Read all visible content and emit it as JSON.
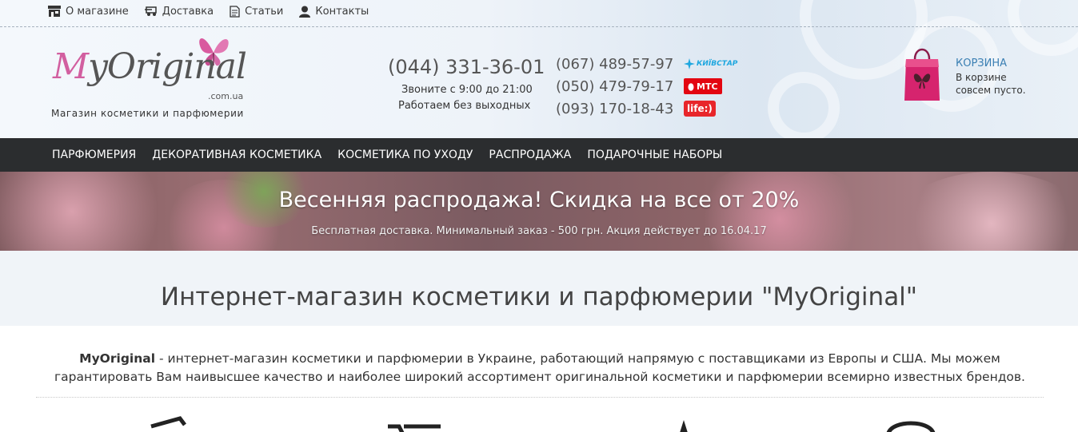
{
  "topnav": {
    "items": [
      {
        "label": "О магазине",
        "icon": "store-icon"
      },
      {
        "label": "Доставка",
        "icon": "truck-icon"
      },
      {
        "label": "Статьи",
        "icon": "document-icon"
      },
      {
        "label": "Контакты",
        "icon": "person-icon"
      }
    ]
  },
  "logo": {
    "name": "MyOriginal",
    "domain": ".com.ua",
    "tagline": "Магазин косметики и парфюмерии",
    "accent_color": "#d25fa0"
  },
  "contacts": {
    "main_phone": "(044) 331-36-01",
    "hours_line1": "Звоните с 9:00 до 21:00",
    "hours_line2": "Работаем без выходных",
    "phones": [
      {
        "number": "(067) 489-57-97",
        "operator": "КИЇВСТАР"
      },
      {
        "number": "(050) 479-79-17",
        "operator": "МТС"
      },
      {
        "number": "(093) 170-18-43",
        "operator": "life:)"
      }
    ]
  },
  "cart": {
    "title": "КОРЗИНА",
    "line1": "В корзине",
    "line2": "совсем пусто.",
    "color": "#d6246e"
  },
  "mainnav": {
    "items": [
      {
        "label": "ПАРФЮМЕРИЯ"
      },
      {
        "label": "ДЕКОРАТИВНАЯ КОСМЕТИКА"
      },
      {
        "label": "КОСМЕТИКА ПО УХОДУ"
      },
      {
        "label": "РАСПРОДАЖА"
      },
      {
        "label": "ПОДАРОЧНЫЕ НАБОРЫ"
      }
    ]
  },
  "banner": {
    "title": "Весенняя распродажа! Скидка на все от 20%",
    "subtitle": "Бесплатная доставка. Минимальный заказ - 500 грн. Акция действует до 16.04.17"
  },
  "content": {
    "title": "Интернет-магазин косметики и парфюмерии \"MyOriginal\"",
    "intro_brand": "MyOriginal",
    "intro_text": " - интернет-магазин косметики и парфюмерии в Украине, работающий напрямую с поставщиками из Европы и США. Мы можем гарантировать Вам наивысшее качество и наиболее широкий ассортимент оригинальной косметики и парфюмерии всемирно известных брендов."
  }
}
